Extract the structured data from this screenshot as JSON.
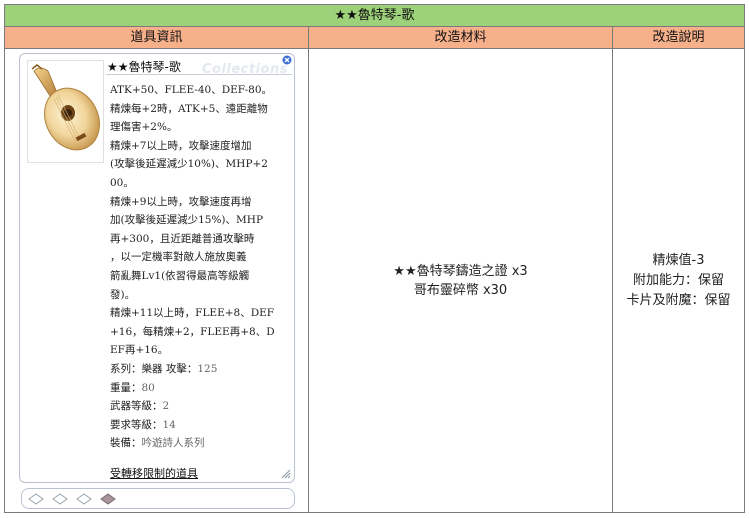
{
  "page": {
    "title": "★★魯特琴-歌"
  },
  "headers": {
    "info": "道具資訊",
    "materials": "改造材料",
    "notes": "改造說明"
  },
  "item": {
    "name": "★★魯特琴-歌",
    "watermark": "Collections",
    "description_lines": [
      "ATK+50、FLEE-40、DEF-80。",
      "精煉每+2時，ATK+5、遠距離物",
      "理傷害+2%。",
      "精煉+7以上時，攻擊速度增加",
      "(攻擊後延遲減少10%)、MHP+2",
      "00。",
      "精煉+9以上時，攻擊速度再增",
      "加(攻擊後延遲減少15%)、MHP",
      "再+300，且近距離普通攻擊時",
      "，以一定機率對敵人施放奧義",
      "箭亂舞Lv1(依習得最高等級觸",
      "發)。",
      "精煉+11以上時，FLEE+8、DEF",
      "+16，每精煉+2，FLEE再+8、D",
      "EF再+16。"
    ],
    "stats": [
      {
        "label": "系列：樂器 攻擊：",
        "value": "125"
      },
      {
        "label": "重量：",
        "value": "80"
      },
      {
        "label": "武器等級：",
        "value": "2"
      },
      {
        "label": "要求等級：",
        "value": "14"
      },
      {
        "label": "裝備：",
        "value": "吟遊詩人系列"
      }
    ],
    "restriction": "受轉移限制的道具",
    "slots": [
      {
        "icon": "empty-slot-icon",
        "filled": false
      },
      {
        "icon": "empty-slot-icon",
        "filled": false
      },
      {
        "icon": "empty-slot-icon",
        "filled": false
      },
      {
        "icon": "filled-slot-icon",
        "filled": true
      }
    ]
  },
  "materials": [
    "★★魯特琴鑄造之證 x3",
    "哥布靈碎幣 x30"
  ],
  "notes": [
    "精煉值-3",
    "附加能力：保留",
    "卡片及附魔：保留"
  ],
  "colors": {
    "title_bg": "#9ed27a",
    "header_bg": "#f6b08a",
    "border": "#7a7a7a"
  }
}
